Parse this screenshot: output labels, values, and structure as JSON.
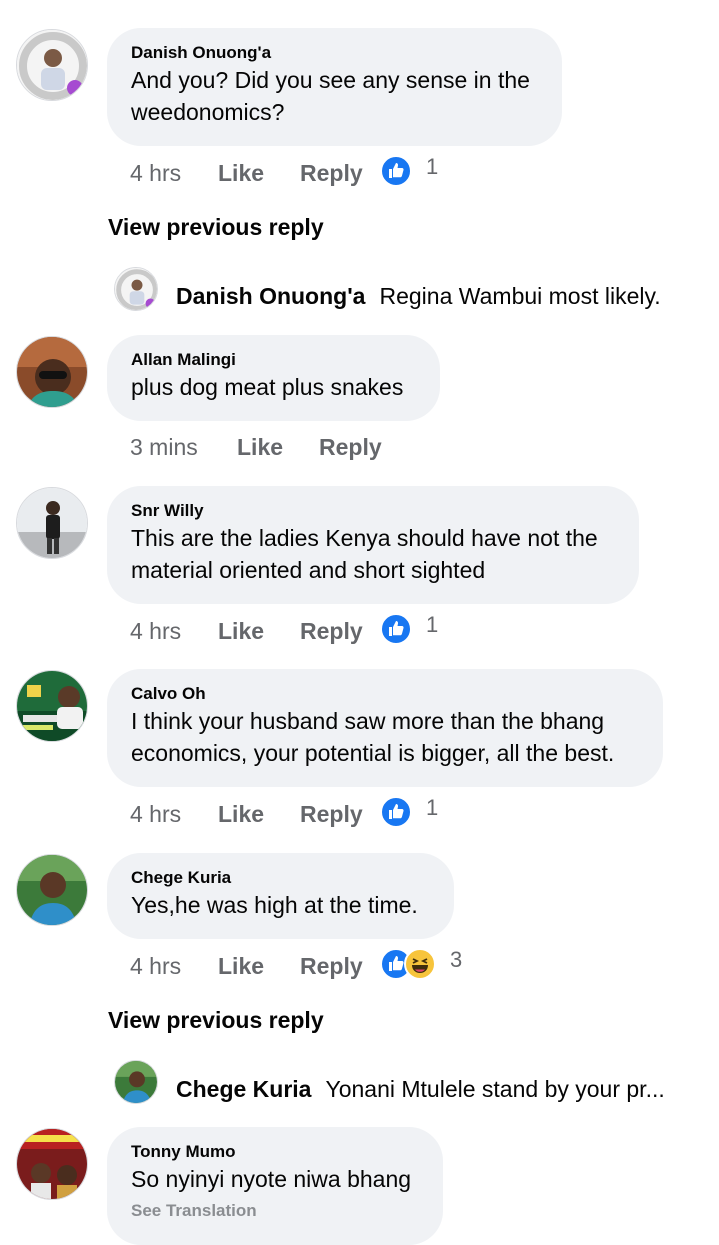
{
  "comments": [
    {
      "name": "Danish Onuong'a",
      "text": "And you? Did you see any sense in the weedonomics?",
      "time": "4 hrs",
      "like": "Like",
      "reply": "Reply",
      "reaction_count": "1"
    },
    {
      "name": "Allan Malingi",
      "text": "plus dog meat plus snakes",
      "time": "3 mins",
      "like": "Like",
      "reply": "Reply"
    },
    {
      "name": "Snr Willy",
      "text": "This are the ladies Kenya should have not the material oriented and short sighted",
      "time": "4 hrs",
      "like": "Like",
      "reply": "Reply",
      "reaction_count": "1"
    },
    {
      "name": "Calvo Oh",
      "text": "I think your husband saw more than the bhang economics, your potential is bigger, all the best.",
      "time": "4 hrs",
      "like": "Like",
      "reply": "Reply",
      "reaction_count": "1"
    },
    {
      "name": "Chege Kuria",
      "text": "Yes,he was high at the time.",
      "time": "4 hrs",
      "like": "Like",
      "reply": "Reply",
      "reaction_count": "3"
    },
    {
      "name": "Tonny Mumo",
      "text": "So nyinyi nyote niwa bhang",
      "see_translation": "See Translation"
    }
  ],
  "view_previous_reply": "View previous reply",
  "replies": [
    {
      "name": "Danish Onuong'a",
      "text": "Regina Wambui most likely."
    },
    {
      "name": "Chege Kuria",
      "text": "Yonani Mtulele stand by your pr..."
    }
  ],
  "colors": {
    "like_blue": "#1877f2",
    "bubble": "#f0f2f5",
    "meta_gray": "#65676b",
    "haha_yellow": "#f7c43b"
  }
}
